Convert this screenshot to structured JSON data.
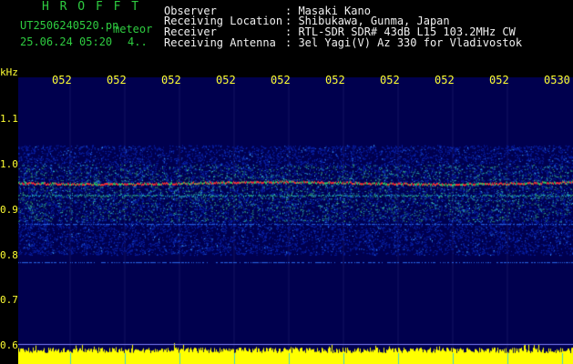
{
  "station": {
    "name": "H R O F F T",
    "file": "UT2506240520.pn",
    "type": "meteor",
    "datetime": "25.06.24 05:20",
    "extra": "4.."
  },
  "info": {
    "observer_label": "Observer",
    "observer_value": ": Masaki Kano",
    "location_label": "Receiving Location",
    "location_value": ": Shibukawa, Gunma, Japan",
    "receiver_label": "Receiver",
    "receiver_value": ": RTL-SDR SDR# 43dB L15 103.2MHz CW",
    "antenna_label": "Receiving Antenna",
    "antenna_value": ": 3el Yagi(V) Az 330 for Vladivostok"
  },
  "axis": {
    "y_unit": "kHz",
    "y_ticks": [
      "1.1",
      "1.0",
      "0.9",
      "0.8",
      "0.7",
      "0.6"
    ],
    "x_ticks": [
      "052",
      "052",
      "052",
      "052",
      "052",
      "052",
      "052",
      "052",
      "052",
      "0530"
    ]
  },
  "colors": {
    "background": "#000000",
    "plot": "#00004e",
    "text": "#ffff33",
    "title": "#2ecc40"
  },
  "chart_data": {
    "type": "heatmap",
    "ylabel": "kHz",
    "ylim": [
      0.6,
      1.15
    ],
    "y_ticks": [
      1.1,
      1.0,
      0.9,
      0.8,
      0.7,
      0.6
    ],
    "x_ticks": [
      "052",
      "052",
      "052",
      "052",
      "052",
      "052",
      "052",
      "052",
      "052",
      "0530"
    ],
    "bands": [
      {
        "freq_khz": 0.94,
        "strength": "strong"
      },
      {
        "freq_khz": 0.915,
        "strength": "medium"
      },
      {
        "freq_khz": 0.855,
        "strength": "weak"
      },
      {
        "freq_khz": 0.775,
        "strength": "weak"
      }
    ]
  }
}
